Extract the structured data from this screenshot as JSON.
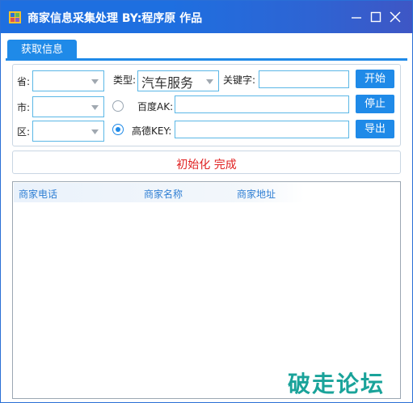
{
  "window": {
    "title": "商家信息采集处理  BY:程序原 作品",
    "app_icon": "app-icon",
    "controls": [
      "minimize-icon",
      "maximize-icon",
      "close-icon"
    ]
  },
  "tabs": [
    {
      "label": "获取信息",
      "active": true
    }
  ],
  "form": {
    "province_label": "省:",
    "province_value": "",
    "city_label": "市:",
    "city_value": "",
    "district_label": "区:",
    "district_value": "",
    "type_label": "类型:",
    "type_value": "汽车服务",
    "keyword_label": "关键字:",
    "keyword_value": "",
    "baidu_label": "百度AK:",
    "baidu_value": "",
    "baidu_selected": false,
    "gaode_label": "高德KEY:",
    "gaode_value": "",
    "gaode_selected": true
  },
  "buttons": {
    "start": "开始",
    "stop": "停止",
    "export": "导出"
  },
  "status": {
    "text": "初始化 完成",
    "color": "#e02020"
  },
  "list": {
    "columns": [
      "商家电话",
      "商家名称",
      "商家地址"
    ],
    "rows": []
  },
  "watermark": "破走论坛",
  "colors": {
    "accent": "#1f8ae8",
    "titlebar": "#1e6fe0",
    "column_header_text": "#2f7fd4",
    "watermark": "#1aa39a"
  }
}
